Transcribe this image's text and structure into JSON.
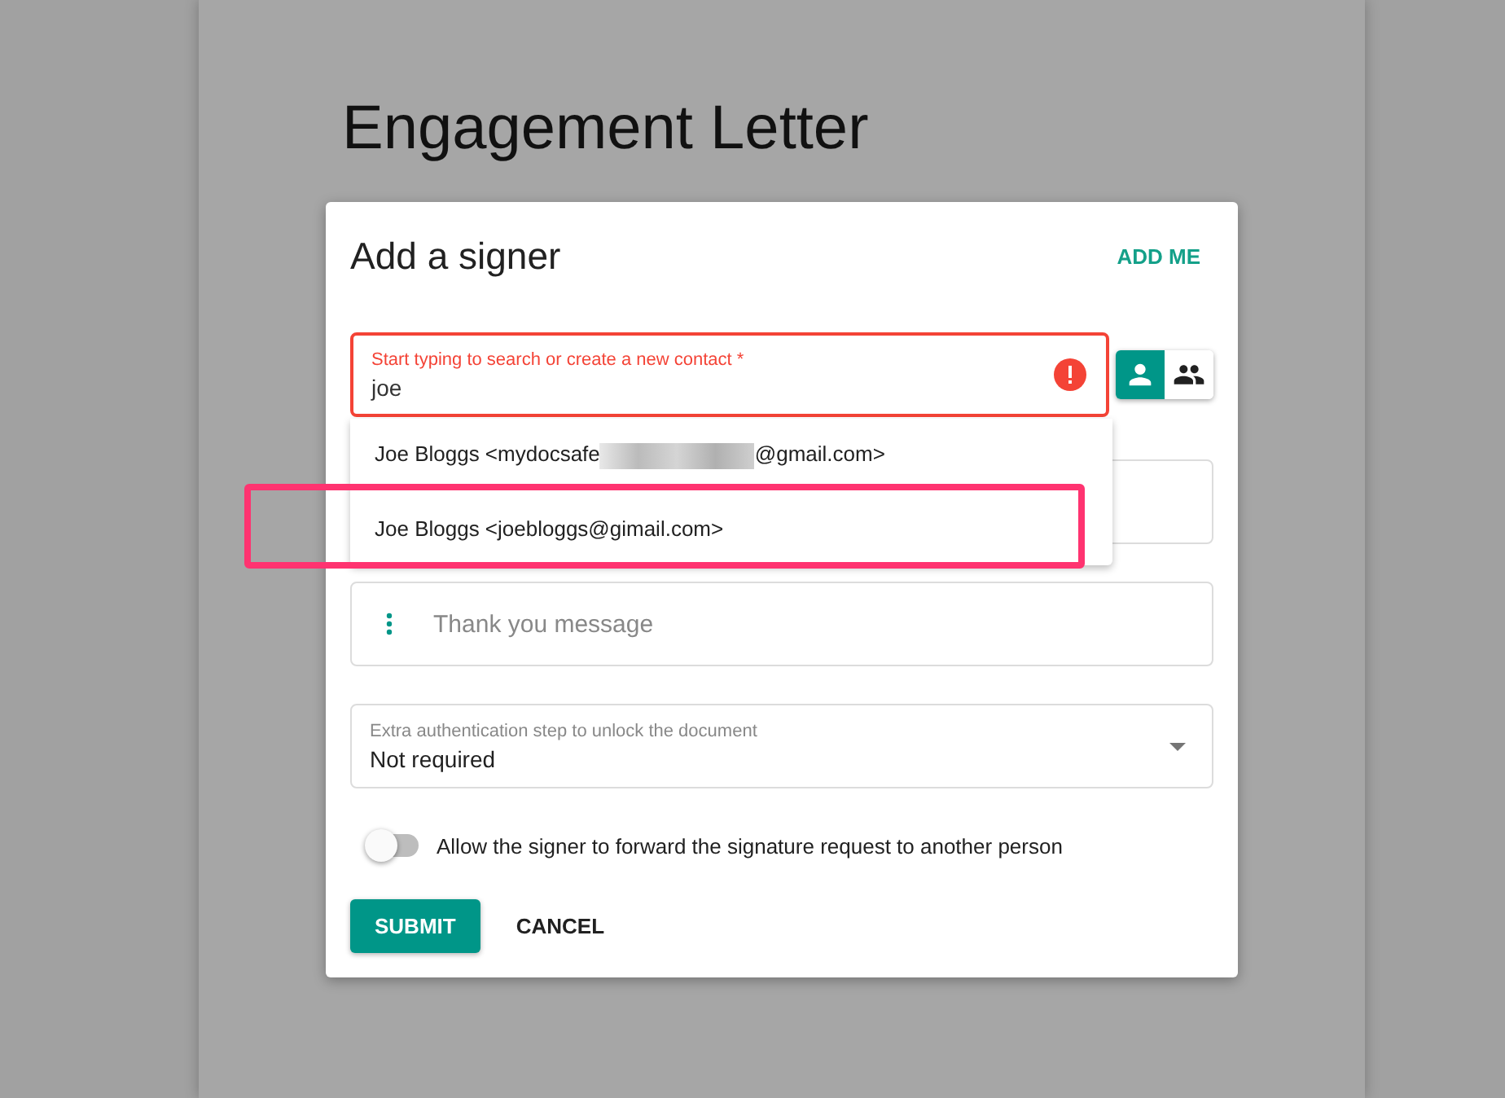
{
  "document": {
    "title": "Engagement Letter"
  },
  "dialog": {
    "title": "Add a signer",
    "add_me_button": "ADD ME"
  },
  "contact_field": {
    "label": "Start typing to search or create a new contact *",
    "value": "joe",
    "error": true
  },
  "signer_modes": [
    {
      "kind": "single",
      "selected": true
    },
    {
      "kind": "group",
      "selected": false
    }
  ],
  "suggestions": [
    {
      "before": "Joe Bloggs <mydocsafe",
      "after": "@gmail.com>",
      "redacted": true,
      "highlighted": false
    },
    {
      "before": "Joe Bloggs <joebloggs@gimail.com>",
      "redacted": false,
      "highlighted": true
    }
  ],
  "message_field": {
    "placeholder": "Thank you message"
  },
  "auth_select": {
    "label": "Extra authentication step to unlock the document",
    "value": "Not required"
  },
  "forward_toggle": {
    "label": "Allow the signer to forward the signature request to another person",
    "on": false
  },
  "buttons": {
    "submit": "SUBMIT",
    "cancel": "CANCEL"
  }
}
